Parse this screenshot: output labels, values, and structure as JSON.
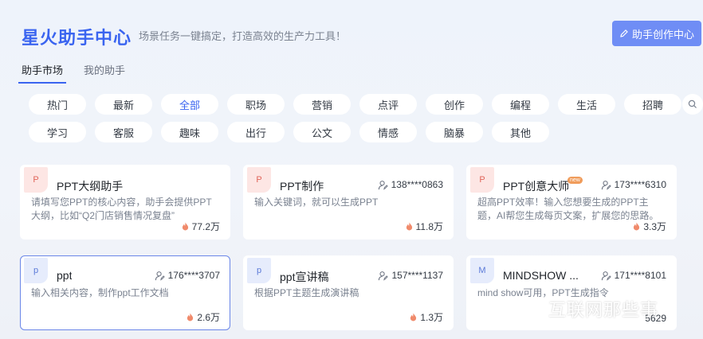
{
  "header": {
    "title": "星火助手中心",
    "subtitle": "场景任务一键搞定，打造高效的生产力工具！",
    "create_button": "助手创作中心"
  },
  "tabs": [
    {
      "label": "助手市场",
      "active": true
    },
    {
      "label": "我的助手",
      "active": false
    }
  ],
  "categories_row1": [
    "热门",
    "最新",
    "全部",
    "职场",
    "营销",
    "点评",
    "创作",
    "编程",
    "生活",
    "招聘"
  ],
  "categories_row2": [
    "学习",
    "客服",
    "趣味",
    "出行",
    "公文",
    "情感",
    "脑暴",
    "其他"
  ],
  "active_category": "全部",
  "cards": [
    {
      "icon": "P",
      "icon_color": "red",
      "title": "PPT大纲助手",
      "author": "",
      "desc": "请填写您PPT的核心内容，助手会提供PPT大纲，比如“Q2门店销售情况复盘”",
      "stat": "77.2万",
      "new": false,
      "selected": false
    },
    {
      "icon": "P",
      "icon_color": "red",
      "title": "PPT制作",
      "author": "138****0863",
      "desc": "输入关键词，就可以生成PPT",
      "stat": "11.8万",
      "new": false,
      "selected": false
    },
    {
      "icon": "P",
      "icon_color": "red",
      "title": "PPT创意大师",
      "author": "173****6310",
      "desc": "超高PPT效率！输入您想要生成的PPT主题，AI帮您生成每页文案，扩展您的思路。",
      "stat": "3.3万",
      "new": true,
      "selected": false
    },
    {
      "icon": "p",
      "icon_color": "blue",
      "title": "ppt",
      "author": "176****3707",
      "desc": "输入相关内容，制作ppt工作文档",
      "stat": "2.6万",
      "new": false,
      "selected": true
    },
    {
      "icon": "p",
      "icon_color": "blue",
      "title": "ppt宣讲稿",
      "author": "157****1137",
      "desc": "根据PPT主题生成演讲稿",
      "stat": "1.3万",
      "new": false,
      "selected": false
    },
    {
      "icon": "M",
      "icon_color": "blue",
      "title": "MINDSHOW ...",
      "author": "171****8101",
      "desc": "mind show可用，PPT生成指令",
      "stat": "5629",
      "new": false,
      "selected": false
    }
  ],
  "new_badge_label": "new",
  "watermark_text": "互联网那些事",
  "colors": {
    "accent": "#3a64f0",
    "button": "#6f8df5",
    "fire": "#f08a6b",
    "card_red_icon": "#fde6e4",
    "card_blue_icon": "#e6ecfc"
  }
}
